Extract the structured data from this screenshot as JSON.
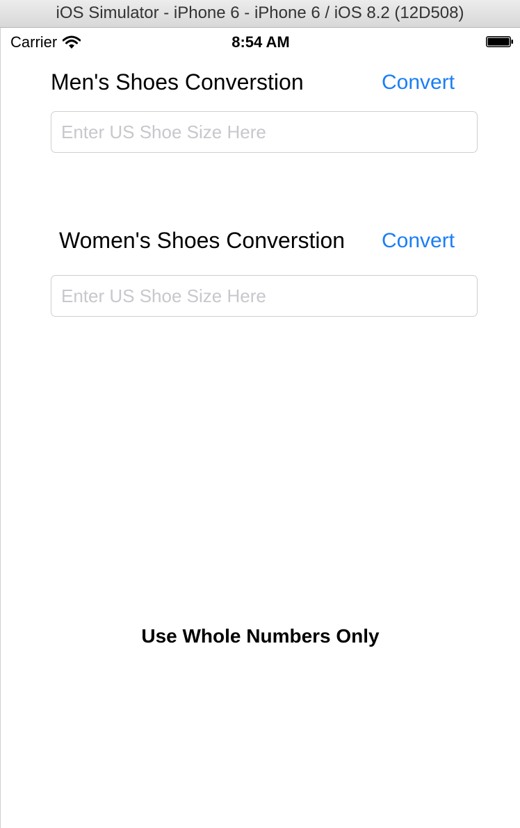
{
  "window": {
    "title": "iOS Simulator - iPhone 6 - iPhone 6 / iOS 8.2 (12D508)"
  },
  "status_bar": {
    "carrier": "Carrier",
    "time": "8:54 AM",
    "icons": [
      "wifi-icon",
      "battery-icon"
    ]
  },
  "mens": {
    "title": "Men's Shoes Converstion",
    "convert_label": "Convert",
    "input_placeholder": "Enter US Shoe Size Here",
    "input_value": ""
  },
  "womens": {
    "title": "Women's Shoes Converstion",
    "convert_label": "Convert",
    "input_placeholder": "Enter US Shoe Size Here",
    "input_value": ""
  },
  "footer": {
    "note": "Use Whole Numbers Only"
  },
  "colors": {
    "accent": "#1a7ef5",
    "placeholder": "#c7c7cd",
    "field_border": "#cfcfcf"
  }
}
